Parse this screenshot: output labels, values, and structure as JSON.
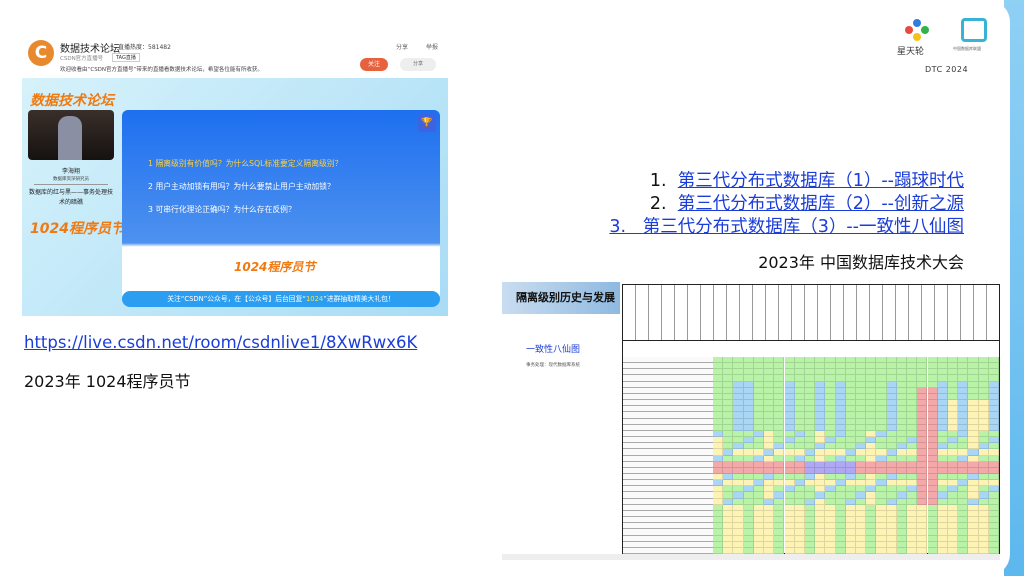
{
  "stream": {
    "channel": "数据技术论坛",
    "hot_label": "直播热度：581482",
    "subtitle": "CSDN官方直播号",
    "tag": "TAG直播",
    "description": "欢迎收看由“CSDN官方直播号”带来的直播看数据技术论坛，希望各位能有所收获。",
    "share": "分享",
    "report": "举报",
    "follow": "关注",
    "more": "分享",
    "title": "数据技术论坛",
    "speaker_name": "李海翔",
    "speaker_role": "数据库资深研究员",
    "topic": "数据库的红与黑——事务处理技术的暗礁",
    "festival": "1024程序员节",
    "badge": "排名",
    "questions": [
      "1 隔离级别有价值吗？为什么SQL标准要定义隔离级别？",
      "2 用户主动加锁有用吗？为什么要禁止用户主动加锁？",
      "3 可串行化理论正确吗？为什么存在反例？"
    ],
    "banner_pre": "关注“CSDN”公众号，在【公众号】后台回复“",
    "banner_code": "1024",
    "banner_post": "”进群抽取精美大礼包！"
  },
  "left": {
    "link": "https://live.csdn.net/room/csdnlive1/8XwRwx6K",
    "caption": "2023年 1024程序员节"
  },
  "logos": {
    "brand1": "星天轮",
    "brand2": "中国数据库联盟",
    "event": "DTC 2024"
  },
  "list": [
    {
      "num": "1.",
      "text": "第三代分布式数据库（1）--蹋球时代"
    },
    {
      "num": "2.",
      "text": "第三代分布式数据库（2）--创新之源"
    },
    {
      "num": "3.",
      "text": "第三代分布式数据库（3）--一致性八仙图"
    }
  ],
  "conference": "2023年 中国数据库技术大会",
  "table_image": {
    "header": "隔离级别历史与发展",
    "subtitle": "一致性八仙图",
    "note": "事务处理：现代数据库系统"
  },
  "colors": {
    "link": "#1a3cd8",
    "accent": "#f07a12",
    "green": "#b9f3a8",
    "blue": "#a9d6f5",
    "yellow": "#fdf3b5",
    "red": "#f3a9a9",
    "purple": "#b0a8f2"
  }
}
